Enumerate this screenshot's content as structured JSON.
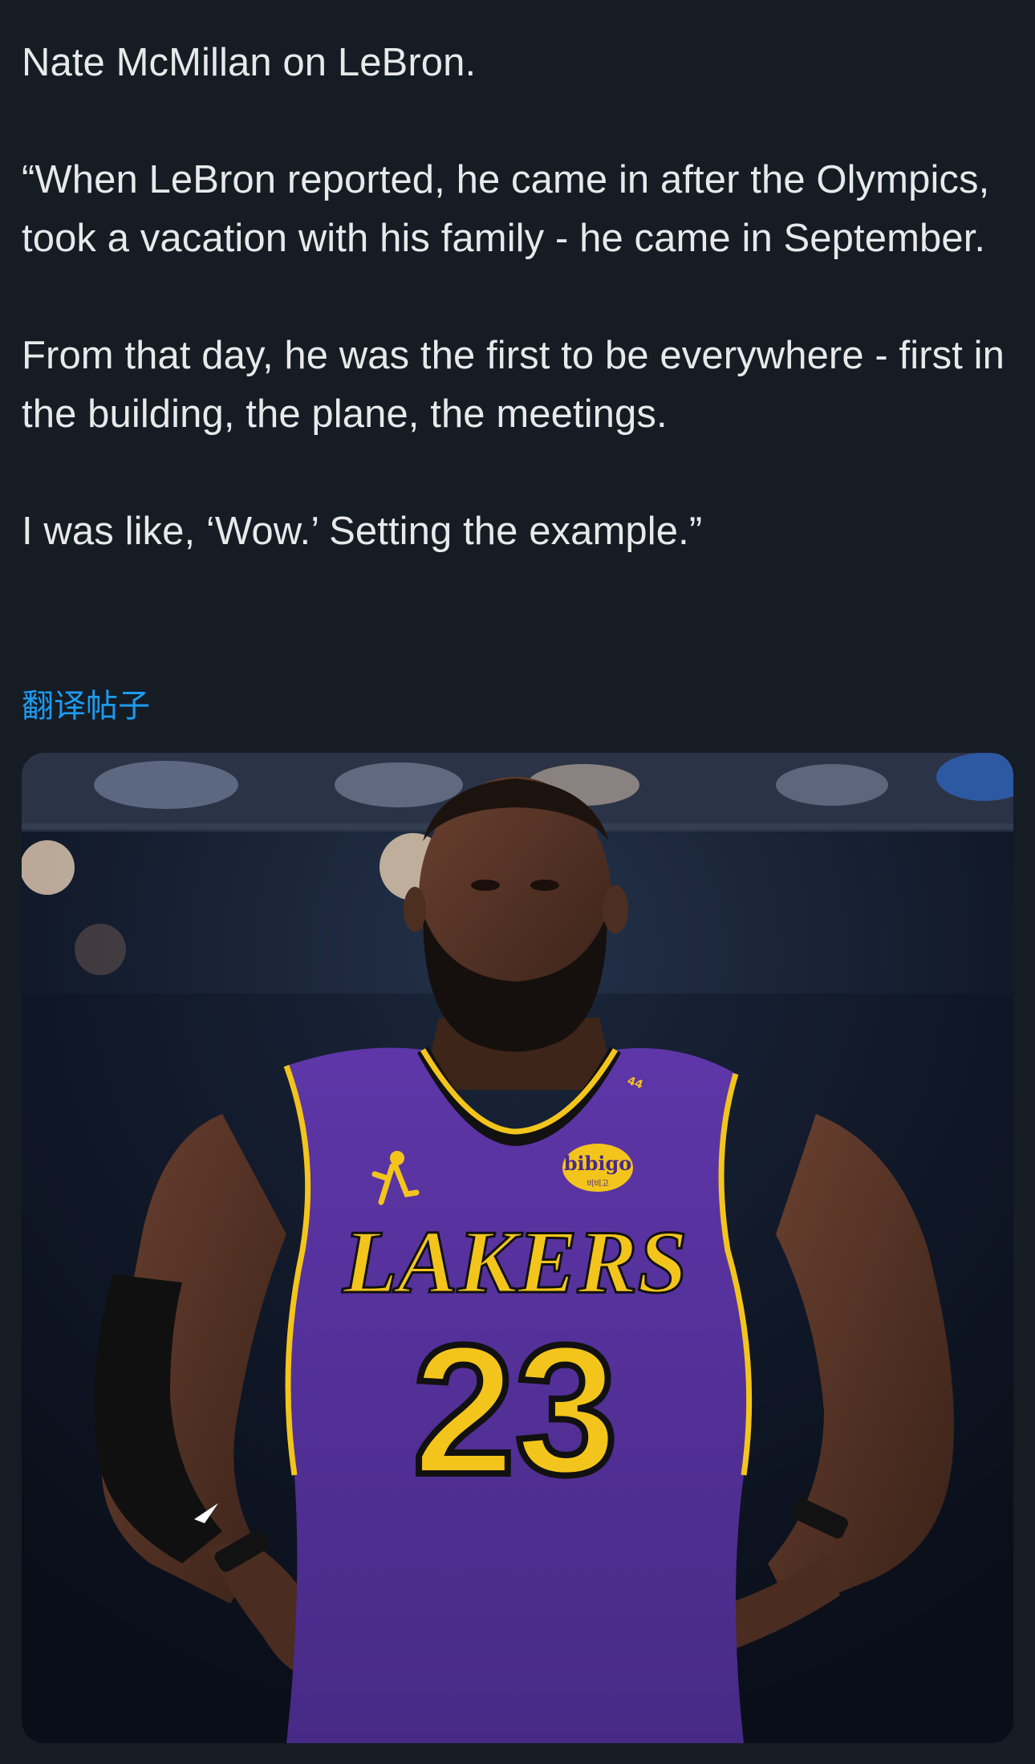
{
  "tweet": {
    "paragraphs": [
      "Nate McMillan on LeBron.",
      "“When LeBron reported, he came in after the Olympics, took a vacation with his family - he came in September.",
      "From that day, he was the first to be everywhere - first in the building, the plane, the meetings.",
      "I was like, ‘Wow.’ Setting the example.”"
    ],
    "translate_label": "翻译帖子"
  },
  "photo": {
    "jersey_team": "LAKERS",
    "jersey_number": "23",
    "patch_text": "bibigo",
    "patch_subtext": "비비고",
    "strap_number": "44"
  },
  "colors": {
    "background": "#151c24",
    "text": "#e7e9ea",
    "link": "#1d9bf0",
    "jersey_purple": "#5a34a0",
    "jersey_gold": "#f3c51c"
  }
}
